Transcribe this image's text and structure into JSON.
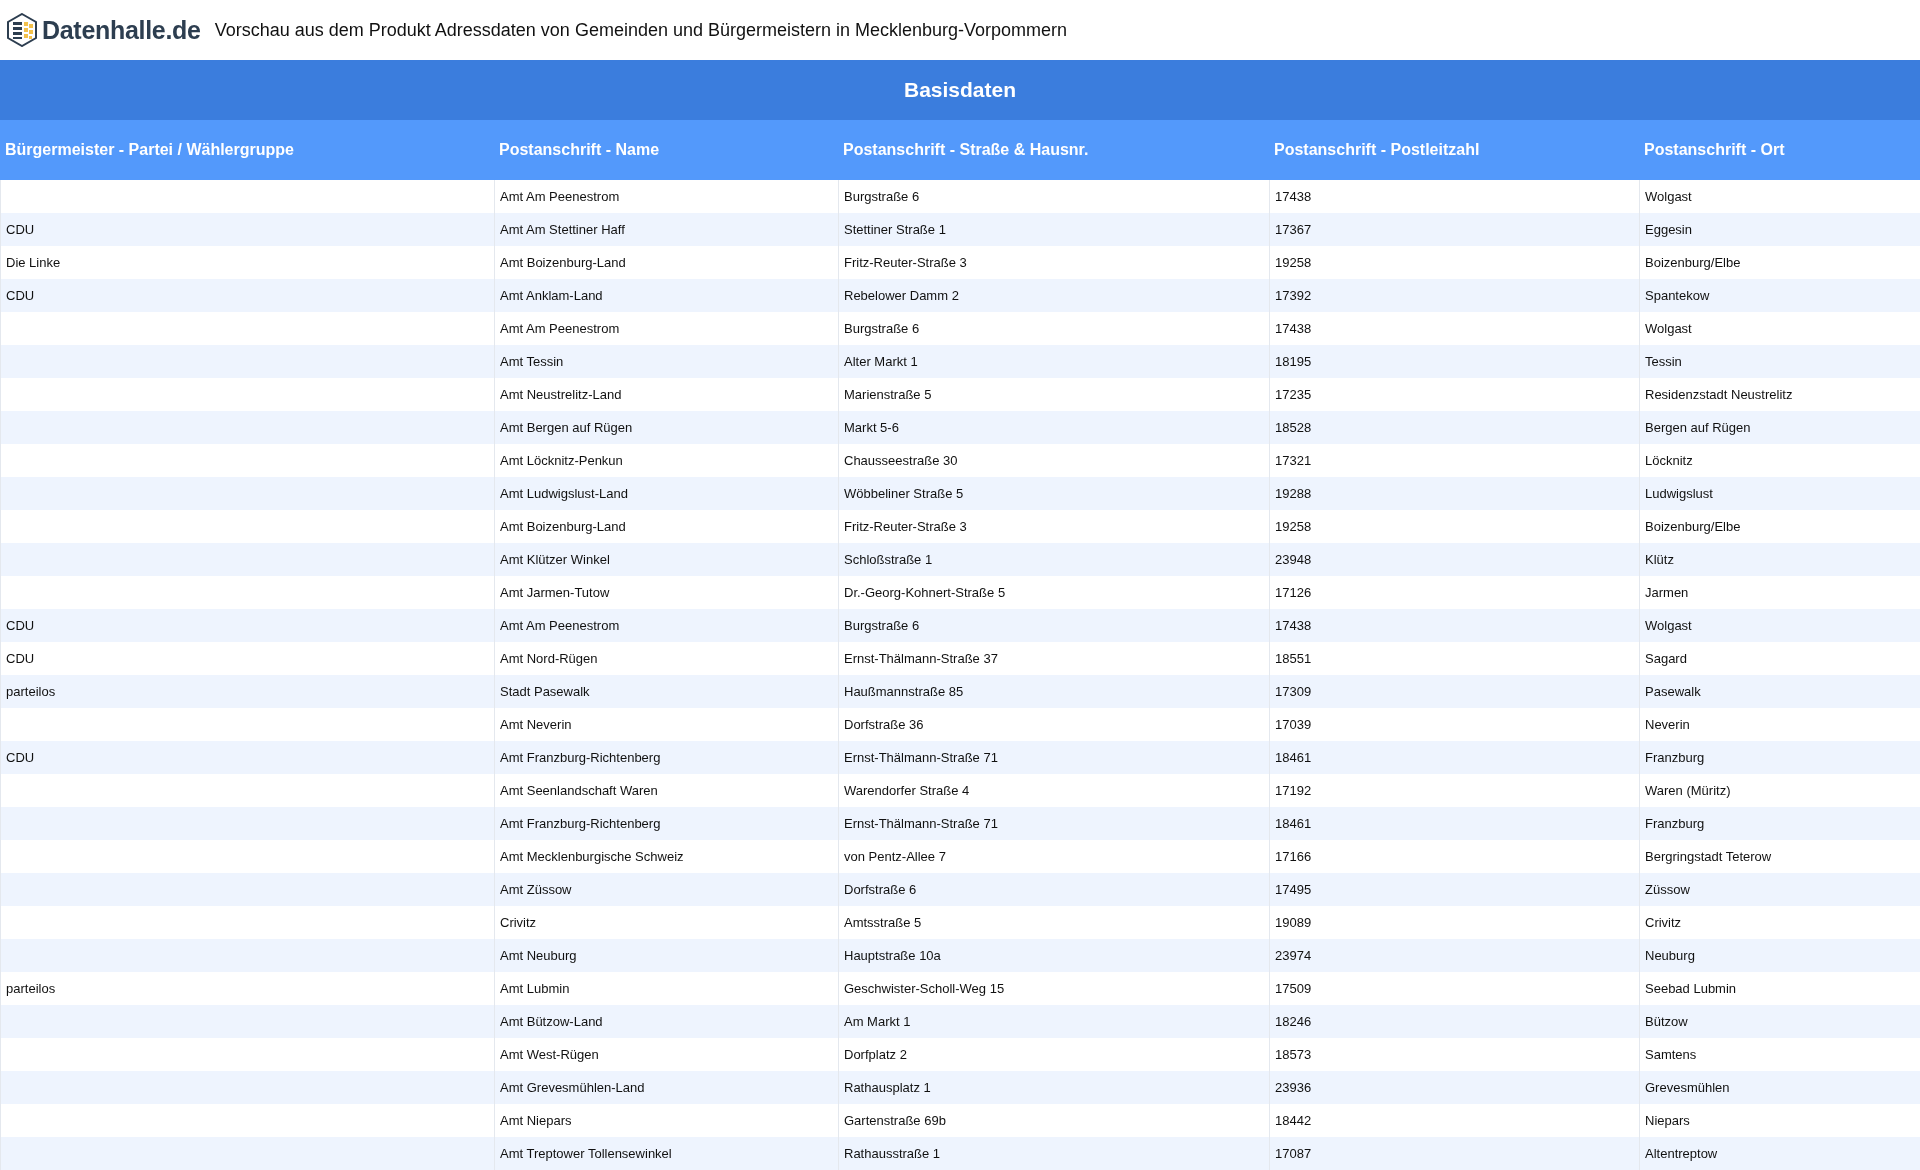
{
  "header": {
    "logo_text": "Datenhalle.de",
    "title": "Vorschau aus dem Produkt Adressdaten von Gemeinden und Bürgermeistern in Mecklenburg-Vorpommern"
  },
  "table": {
    "group_title": "Basisdaten",
    "columns": [
      "Bürgermeister - Partei / Wählergruppe",
      "Postanschrift - Name",
      "Postanschrift - Straße & Hausnr.",
      "Postanschrift - Postleitzahl",
      "Postanschrift - Ort"
    ],
    "rows": [
      {
        "name": "Amt Am Peenestrom",
        "street": "Burgstraße 6",
        "postcode": "17438",
        "city": "Wolgast"
      },
      {
        "party": "CDU",
        "name": "Amt Am Stettiner Haff",
        "street": "Stettiner Straße 1",
        "postcode": "17367",
        "city": "Eggesin"
      },
      {
        "party": "Die Linke",
        "name": "Amt Boizenburg-Land",
        "street": "Fritz-Reuter-Straße 3",
        "postcode": "19258",
        "city": "Boizenburg/Elbe"
      },
      {
        "party": "CDU",
        "name": "Amt Anklam-Land",
        "street": "Rebelower Damm 2",
        "postcode": "17392",
        "city": "Spantekow"
      },
      {
        "name": "Amt Am Peenestrom",
        "street": "Burgstraße 6",
        "postcode": "17438",
        "city": "Wolgast"
      },
      {
        "name": "Amt Tessin",
        "street": "Alter Markt 1",
        "postcode": "18195",
        "city": "Tessin"
      },
      {
        "name": "Amt Neustrelitz-Land",
        "street": "Marienstraße 5",
        "postcode": "17235",
        "city": "Residenzstadt Neustrelitz"
      },
      {
        "name": "Amt Bergen auf Rügen",
        "street": "Markt 5-6",
        "postcode": "18528",
        "city": "Bergen auf Rügen"
      },
      {
        "name": "Amt Löcknitz-Penkun",
        "street": "Chausseestraße 30",
        "postcode": "17321",
        "city": "Löcknitz"
      },
      {
        "name": "Amt Ludwigslust-Land",
        "street": "Wöbbeliner Straße 5",
        "postcode": "19288",
        "city": "Ludwigslust"
      },
      {
        "name": "Amt Boizenburg-Land",
        "street": "Fritz-Reuter-Straße 3",
        "postcode": "19258",
        "city": "Boizenburg/Elbe"
      },
      {
        "name": "Amt Klützer Winkel",
        "street": "Schloßstraße 1",
        "postcode": "23948",
        "city": "Klütz"
      },
      {
        "name": "Amt Jarmen-Tutow",
        "street": "Dr.-Georg-Kohnert-Straße 5",
        "postcode": "17126",
        "city": "Jarmen"
      },
      {
        "party": "CDU",
        "name": "Amt Am Peenestrom",
        "street": "Burgstraße 6",
        "postcode": "17438",
        "city": "Wolgast"
      },
      {
        "party": "CDU",
        "name": "Amt Nord-Rügen",
        "street": "Ernst-Thälmann-Straße 37",
        "postcode": "18551",
        "city": "Sagard"
      },
      {
        "party": "parteilos",
        "name": "Stadt Pasewalk",
        "street": "Haußmannstraße 85",
        "postcode": "17309",
        "city": "Pasewalk"
      },
      {
        "name": "Amt Neverin",
        "street": "Dorfstraße 36",
        "postcode": "17039",
        "city": "Neverin"
      },
      {
        "party": "CDU",
        "name": "Amt Franzburg-Richtenberg",
        "street": "Ernst-Thälmann-Straße 71",
        "postcode": "18461",
        "city": "Franzburg"
      },
      {
        "name": "Amt Seenlandschaft Waren",
        "street": "Warendorfer Straße 4",
        "postcode": "17192",
        "city": "Waren (Müritz)"
      },
      {
        "name": "Amt Franzburg-Richtenberg",
        "street": "Ernst-Thälmann-Straße 71",
        "postcode": "18461",
        "city": "Franzburg"
      },
      {
        "name": "Amt Mecklenburgische Schweiz",
        "street": "von Pentz-Allee 7",
        "postcode": "17166",
        "city": "Bergringstadt Teterow"
      },
      {
        "name": "Amt Züssow",
        "street": "Dorfstraße 6",
        "postcode": "17495",
        "city": "Züssow"
      },
      {
        "name": "Crivitz",
        "street": "Amtsstraße 5",
        "postcode": "19089",
        "city": "Crivitz"
      },
      {
        "name": "Amt Neuburg",
        "street": "Hauptstraße 10a",
        "postcode": "23974",
        "city": "Neuburg"
      },
      {
        "party": "parteilos",
        "name": "Amt Lubmin",
        "street": "Geschwister-Scholl-Weg 15",
        "postcode": "17509",
        "city": "Seebad Lubmin"
      },
      {
        "name": "Amt Bützow-Land",
        "street": "Am Markt 1",
        "postcode": "18246",
        "city": "Bützow"
      },
      {
        "name": "Amt West-Rügen",
        "street": "Dorfplatz 2",
        "postcode": "18573",
        "city": "Samtens"
      },
      {
        "name": "Amt Grevesmühlen-Land",
        "street": "Rathausplatz 1",
        "postcode": "23936",
        "city": "Grevesmühlen"
      },
      {
        "name": "Amt Niepars",
        "street": "Gartenstraße 69b",
        "postcode": "18442",
        "city": "Niepars"
      },
      {
        "name": "Amt Treptower Tollensewinkel",
        "street": "Rathausstraße 1",
        "postcode": "17087",
        "city": "Altentreptow"
      }
    ]
  }
}
